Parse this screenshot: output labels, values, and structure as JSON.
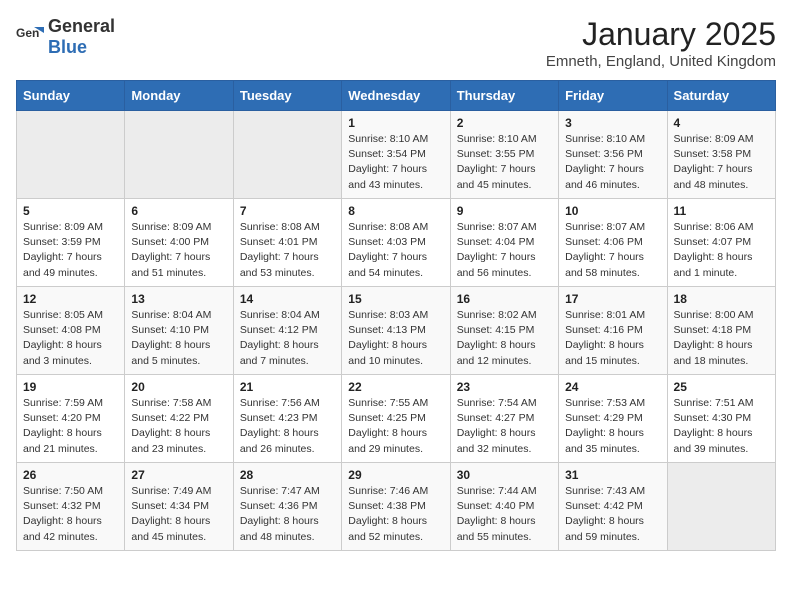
{
  "logo": {
    "general": "General",
    "blue": "Blue"
  },
  "title": "January 2025",
  "subtitle": "Emneth, England, United Kingdom",
  "days_of_week": [
    "Sunday",
    "Monday",
    "Tuesday",
    "Wednesday",
    "Thursday",
    "Friday",
    "Saturday"
  ],
  "weeks": [
    [
      {
        "day": "",
        "info": ""
      },
      {
        "day": "",
        "info": ""
      },
      {
        "day": "",
        "info": ""
      },
      {
        "day": "1",
        "info": "Sunrise: 8:10 AM\nSunset: 3:54 PM\nDaylight: 7 hours\nand 43 minutes."
      },
      {
        "day": "2",
        "info": "Sunrise: 8:10 AM\nSunset: 3:55 PM\nDaylight: 7 hours\nand 45 minutes."
      },
      {
        "day": "3",
        "info": "Sunrise: 8:10 AM\nSunset: 3:56 PM\nDaylight: 7 hours\nand 46 minutes."
      },
      {
        "day": "4",
        "info": "Sunrise: 8:09 AM\nSunset: 3:58 PM\nDaylight: 7 hours\nand 48 minutes."
      }
    ],
    [
      {
        "day": "5",
        "info": "Sunrise: 8:09 AM\nSunset: 3:59 PM\nDaylight: 7 hours\nand 49 minutes."
      },
      {
        "day": "6",
        "info": "Sunrise: 8:09 AM\nSunset: 4:00 PM\nDaylight: 7 hours\nand 51 minutes."
      },
      {
        "day": "7",
        "info": "Sunrise: 8:08 AM\nSunset: 4:01 PM\nDaylight: 7 hours\nand 53 minutes."
      },
      {
        "day": "8",
        "info": "Sunrise: 8:08 AM\nSunset: 4:03 PM\nDaylight: 7 hours\nand 54 minutes."
      },
      {
        "day": "9",
        "info": "Sunrise: 8:07 AM\nSunset: 4:04 PM\nDaylight: 7 hours\nand 56 minutes."
      },
      {
        "day": "10",
        "info": "Sunrise: 8:07 AM\nSunset: 4:06 PM\nDaylight: 7 hours\nand 58 minutes."
      },
      {
        "day": "11",
        "info": "Sunrise: 8:06 AM\nSunset: 4:07 PM\nDaylight: 8 hours\nand 1 minute."
      }
    ],
    [
      {
        "day": "12",
        "info": "Sunrise: 8:05 AM\nSunset: 4:08 PM\nDaylight: 8 hours\nand 3 minutes."
      },
      {
        "day": "13",
        "info": "Sunrise: 8:04 AM\nSunset: 4:10 PM\nDaylight: 8 hours\nand 5 minutes."
      },
      {
        "day": "14",
        "info": "Sunrise: 8:04 AM\nSunset: 4:12 PM\nDaylight: 8 hours\nand 7 minutes."
      },
      {
        "day": "15",
        "info": "Sunrise: 8:03 AM\nSunset: 4:13 PM\nDaylight: 8 hours\nand 10 minutes."
      },
      {
        "day": "16",
        "info": "Sunrise: 8:02 AM\nSunset: 4:15 PM\nDaylight: 8 hours\nand 12 minutes."
      },
      {
        "day": "17",
        "info": "Sunrise: 8:01 AM\nSunset: 4:16 PM\nDaylight: 8 hours\nand 15 minutes."
      },
      {
        "day": "18",
        "info": "Sunrise: 8:00 AM\nSunset: 4:18 PM\nDaylight: 8 hours\nand 18 minutes."
      }
    ],
    [
      {
        "day": "19",
        "info": "Sunrise: 7:59 AM\nSunset: 4:20 PM\nDaylight: 8 hours\nand 21 minutes."
      },
      {
        "day": "20",
        "info": "Sunrise: 7:58 AM\nSunset: 4:22 PM\nDaylight: 8 hours\nand 23 minutes."
      },
      {
        "day": "21",
        "info": "Sunrise: 7:56 AM\nSunset: 4:23 PM\nDaylight: 8 hours\nand 26 minutes."
      },
      {
        "day": "22",
        "info": "Sunrise: 7:55 AM\nSunset: 4:25 PM\nDaylight: 8 hours\nand 29 minutes."
      },
      {
        "day": "23",
        "info": "Sunrise: 7:54 AM\nSunset: 4:27 PM\nDaylight: 8 hours\nand 32 minutes."
      },
      {
        "day": "24",
        "info": "Sunrise: 7:53 AM\nSunset: 4:29 PM\nDaylight: 8 hours\nand 35 minutes."
      },
      {
        "day": "25",
        "info": "Sunrise: 7:51 AM\nSunset: 4:30 PM\nDaylight: 8 hours\nand 39 minutes."
      }
    ],
    [
      {
        "day": "26",
        "info": "Sunrise: 7:50 AM\nSunset: 4:32 PM\nDaylight: 8 hours\nand 42 minutes."
      },
      {
        "day": "27",
        "info": "Sunrise: 7:49 AM\nSunset: 4:34 PM\nDaylight: 8 hours\nand 45 minutes."
      },
      {
        "day": "28",
        "info": "Sunrise: 7:47 AM\nSunset: 4:36 PM\nDaylight: 8 hours\nand 48 minutes."
      },
      {
        "day": "29",
        "info": "Sunrise: 7:46 AM\nSunset: 4:38 PM\nDaylight: 8 hours\nand 52 minutes."
      },
      {
        "day": "30",
        "info": "Sunrise: 7:44 AM\nSunset: 4:40 PM\nDaylight: 8 hours\nand 55 minutes."
      },
      {
        "day": "31",
        "info": "Sunrise: 7:43 AM\nSunset: 4:42 PM\nDaylight: 8 hours\nand 59 minutes."
      },
      {
        "day": "",
        "info": ""
      }
    ]
  ]
}
